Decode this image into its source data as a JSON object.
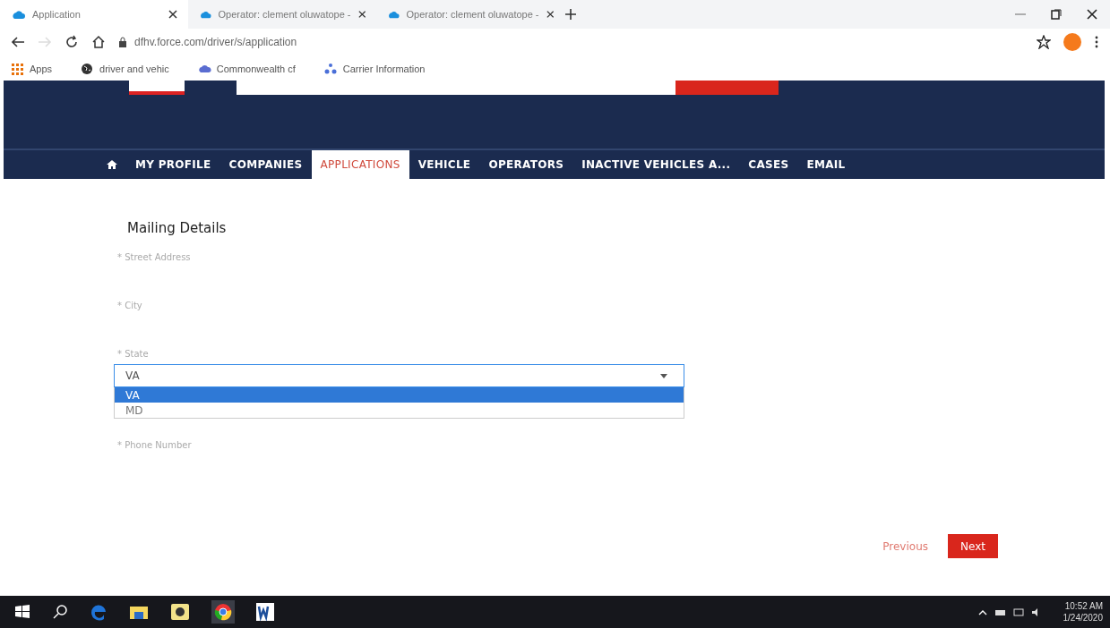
{
  "browser": {
    "tabs": [
      {
        "title": "Application",
        "selected": true
      },
      {
        "title": "Operator: clement oluwatope -",
        "selected": false
      },
      {
        "title": "Operator: clement oluwatope -",
        "selected": false
      }
    ],
    "url": "dfhv.force.com/driver/s/application",
    "bookmarks": [
      {
        "label": "Apps",
        "kind": "apps"
      },
      {
        "label": "driver and vehic",
        "kind": "globe"
      },
      {
        "label": "Commonwealth cf",
        "kind": "cloud"
      },
      {
        "label": "Carrier Information",
        "kind": "people"
      }
    ]
  },
  "nav": {
    "items": [
      {
        "label": "MY PROFILE",
        "selected": false
      },
      {
        "label": "COMPANIES",
        "selected": false
      },
      {
        "label": "APPLICATIONS",
        "selected": true
      },
      {
        "label": "VEHICLE",
        "selected": false
      },
      {
        "label": "OPERATORS",
        "selected": false
      },
      {
        "label": "INACTIVE VEHICLES A...",
        "selected": false
      },
      {
        "label": "CASES",
        "selected": false
      },
      {
        "label": "EMAIL",
        "selected": false
      }
    ]
  },
  "form": {
    "title": "Mailing Details",
    "fields": [
      {
        "label": "* Street Address",
        "kind": "text"
      },
      {
        "label": "* City",
        "kind": "text"
      },
      {
        "label": "* State",
        "kind": "select",
        "value": "VA",
        "expanded": true,
        "options": [
          {
            "label": "VA",
            "selected": true
          },
          {
            "label": "MD",
            "selected": false
          }
        ]
      },
      {
        "label": "* Phone Number",
        "kind": "text"
      }
    ],
    "buttons": [
      {
        "label": "Previous",
        "kind": "link"
      },
      {
        "label": "Next",
        "kind": "primary"
      }
    ]
  },
  "taskbar": {
    "time": "10:52 AM",
    "date": "1/24/2020"
  }
}
